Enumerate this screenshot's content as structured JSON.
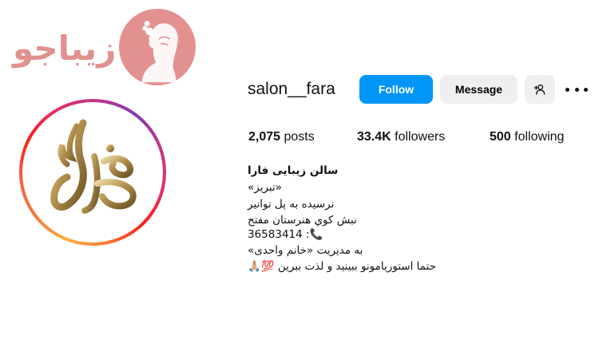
{
  "brand": {
    "text": "زیباجو",
    "color": "#e0918e",
    "icon": "woman-silhouette-logo"
  },
  "profile": {
    "username": "salon__fara",
    "avatar_text": "فارا",
    "follow_label": "Follow",
    "message_label": "Message",
    "add_icon": "add-person-icon",
    "more_icon": "more-options-icon"
  },
  "stats": {
    "posts_count": "2,075",
    "posts_label": "posts",
    "followers_count": "33.4K",
    "followers_label": "followers",
    "following_count": "500",
    "following_label": "following"
  },
  "bio": {
    "name": "سالن زیبایی فارا",
    "lines": [
      "«تبریز»",
      "نرسیده به پل توانیر",
      "نبش کوي هنرستان مفتح",
      "36583414 :📞",
      "به مدیریت «خانم واحدی»",
      "حتما استوریامونو ببینید و لذت ببرین 💯🙏🏼"
    ]
  },
  "colors": {
    "accent": "#0095f6",
    "secondary_button": "#efefef",
    "gold": "#b89a55"
  }
}
